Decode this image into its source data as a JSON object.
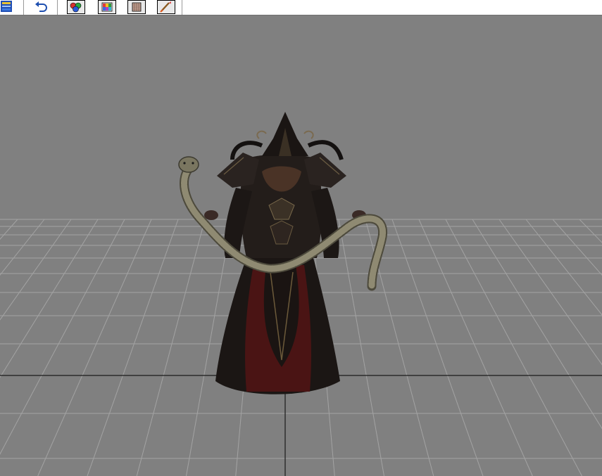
{
  "toolbar": {
    "tools": [
      {
        "icon": "app-menu-icon"
      },
      {
        "icon": "undo-icon"
      },
      {
        "icon": "color-balls-icon"
      },
      {
        "icon": "texture-palette-icon"
      },
      {
        "icon": "grid-frame-icon"
      },
      {
        "icon": "paint-brush-icon"
      }
    ]
  },
  "viewport": {
    "background_color": "#808080",
    "grid_line_color": "#a3a3a3",
    "grid_axis_color": "#1a1a1a",
    "subject": "robed-sorceress-with-snake-model"
  }
}
